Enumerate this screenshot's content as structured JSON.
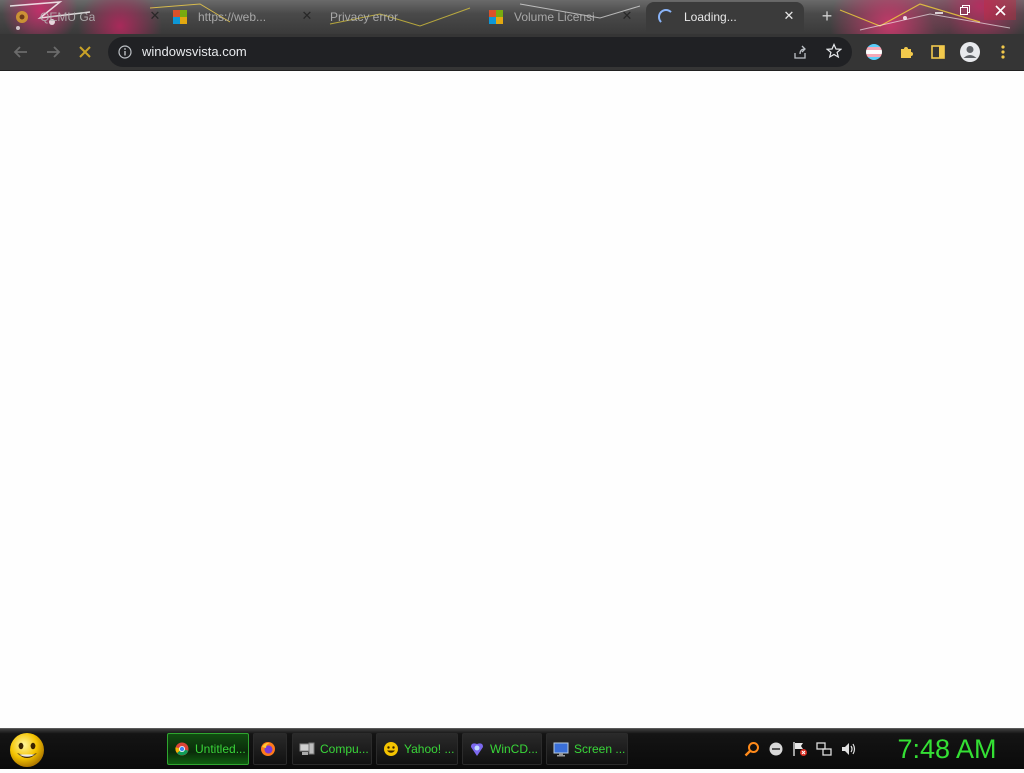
{
  "browser": {
    "tabs": [
      {
        "title": "QEMU Ga",
        "icon": "app-icon",
        "active": false
      },
      {
        "title": "https://web...",
        "icon": "microsoft-logo-icon",
        "active": false
      },
      {
        "title": "Privacy error",
        "icon": "",
        "active": false
      },
      {
        "title": "Volume Licensi",
        "icon": "microsoft-logo-icon",
        "active": false
      },
      {
        "title": "Loading...",
        "icon": "loading-spinner-icon",
        "active": true
      }
    ],
    "new_tab_label": "+",
    "address": {
      "url": "windowsvista.com"
    }
  },
  "taskbar": {
    "items": [
      {
        "label": "Untitled...",
        "icon": "chrome-icon",
        "active": true
      },
      {
        "label": "",
        "icon": "firefox-icon",
        "active": false
      },
      {
        "label": "Compu...",
        "icon": "computer-icon",
        "active": false
      },
      {
        "label": "Yahoo! ...",
        "icon": "yahoo-smiley-icon",
        "active": false
      },
      {
        "label": "WinCD...",
        "icon": "wincdemu-icon",
        "active": false
      },
      {
        "label": "Screen ...",
        "icon": "screen-monitor-icon",
        "active": false
      }
    ],
    "clock": "7:48 AM"
  },
  "colors": {
    "taskbar_text": "#39d639",
    "clock_text": "#34e034",
    "toolbar_bg": "#353535",
    "omnibox_bg": "#202124"
  }
}
